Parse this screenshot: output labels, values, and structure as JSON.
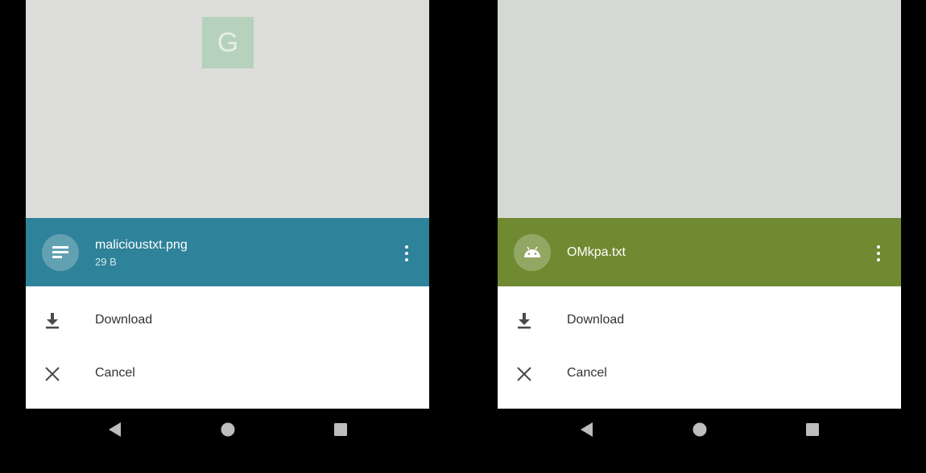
{
  "screens": [
    {
      "background_logo": "G",
      "file": {
        "name": "malicioustxt.png",
        "size": "29 B",
        "icon": "text-document-icon",
        "header_color": "#2e8299"
      },
      "actions": [
        {
          "label": "Download",
          "icon": "download-icon"
        },
        {
          "label": "Cancel",
          "icon": "close-icon"
        }
      ]
    },
    {
      "file": {
        "name": "OMkpa.txt",
        "icon": "android-icon",
        "header_color": "#6f8a31"
      },
      "actions": [
        {
          "label": "Download",
          "icon": "download-icon"
        },
        {
          "label": "Cancel",
          "icon": "close-icon"
        }
      ]
    }
  ],
  "navbar": {
    "back_icon": "back-triangle-icon",
    "home_icon": "home-circle-icon",
    "recents_icon": "recents-square-icon"
  }
}
